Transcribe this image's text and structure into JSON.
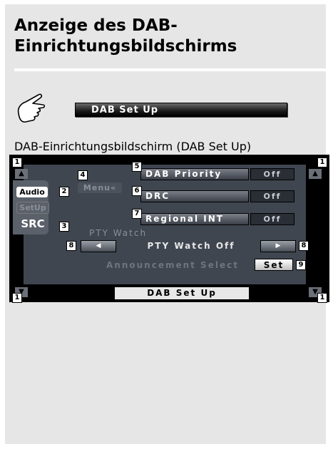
{
  "heading_line1": "Anzeige des DAB-",
  "heading_line2": "Einrichtungsbildschirms",
  "touch_button": "DAB Set Up",
  "caption": "DAB-Einrichtungsbildschirm (DAB Set Up)",
  "screen": {
    "menu_label": "Menu«",
    "side": {
      "audio": "Audio",
      "setup": "SetUp",
      "src": "SRC"
    },
    "rows": [
      {
        "label": "DAB Priority",
        "value": "Off"
      },
      {
        "label": "DRC",
        "value": "Off"
      },
      {
        "label": "Regional INT",
        "value": "Off"
      }
    ],
    "pty_heading": "PTY Watch",
    "pty_value": "PTY Watch Off",
    "announcement_label": "Announcement Select",
    "announcement_button": "Set",
    "footer_title": "DAB Set Up"
  },
  "callouts": {
    "c1": "1",
    "c2": "2",
    "c3": "3",
    "c4": "4",
    "c5": "5",
    "c6": "6",
    "c7": "7",
    "c8": "8",
    "c9": "9"
  },
  "colors": {
    "page_bg": "#e6e6e6",
    "screen_bg": "#000000",
    "panel_bg": "#3f4650"
  }
}
